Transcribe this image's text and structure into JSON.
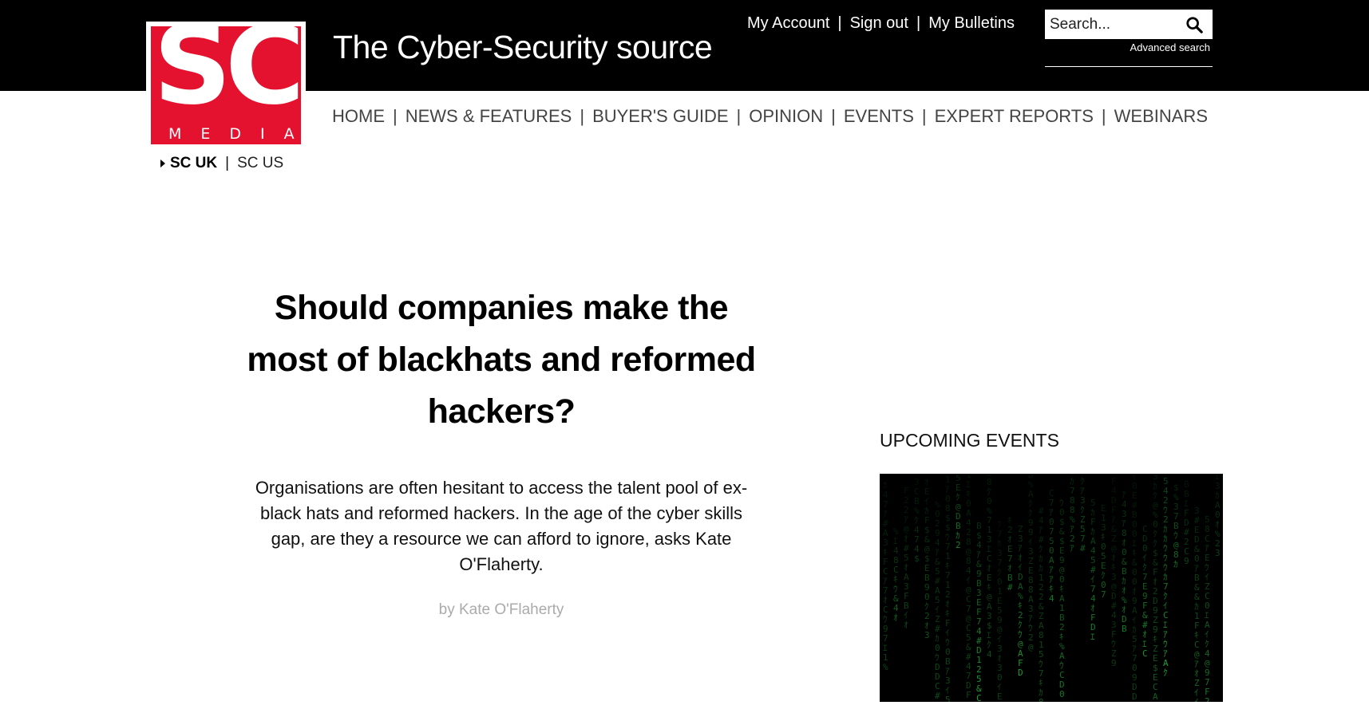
{
  "header": {
    "tagline": "The Cyber-Security source",
    "logo": {
      "letters": "SC",
      "word": "MEDIA",
      "color": "#e4122f"
    },
    "account_links": [
      "My Account",
      "Sign out",
      "My Bulletins"
    ],
    "search": {
      "placeholder": "Search...",
      "icon": "search-icon",
      "advanced_label": "Advanced search"
    },
    "separator": "|"
  },
  "nav": {
    "items": [
      "HOME",
      "NEWS & FEATURES",
      "BUYER'S GUIDE",
      "OPINION",
      "EVENTS",
      "EXPERT REPORTS",
      "WEBINARS"
    ]
  },
  "region": {
    "active": "SC UK",
    "other": "SC US"
  },
  "article": {
    "headline": "Should companies make the most of blackhats and reformed hackers?",
    "standfirst": "Organisations are often hesitant to access the talent pool of ex-black hats and reformed hackers. In the age of the cyber skills gap, are they a resource we can afford to ignore, asks Kate O'Flaherty.",
    "byline": "by Kate O'Flaherty"
  },
  "sidebar": {
    "events_title": "UPCOMING EVENTS",
    "events_image": "matrix-code-image"
  },
  "colors": {
    "topbar": "#000000",
    "brand_red": "#e4122f",
    "matrix_green": "#1fa83a"
  }
}
